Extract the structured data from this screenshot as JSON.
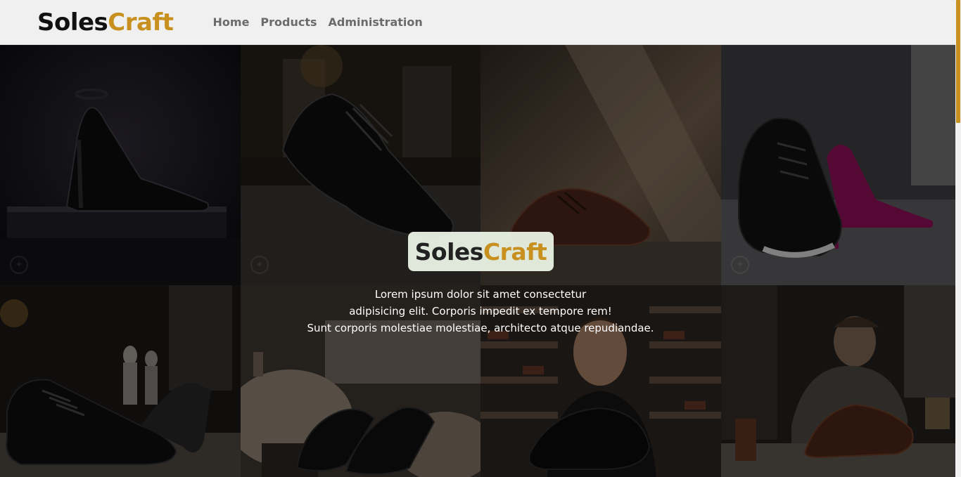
{
  "brand": {
    "part1": "Soles",
    "part2": "Craft",
    "accent_color": "#c8901e"
  },
  "nav": {
    "items": [
      {
        "label": "Home"
      },
      {
        "label": "Products"
      },
      {
        "label": "Administration"
      }
    ]
  },
  "hero": {
    "logo_part1": "Soles",
    "logo_part2": "Craft",
    "text_line1": "Lorem ipsum dolor sit amet consectetur",
    "text_line2": "adipisicing elit. Corporis impedit ex tempore rem!",
    "text_line3": "Sunt corporis molestiae molestiae, architecto atque repudiandae."
  },
  "gallery": {
    "images": [
      {
        "icon": "black-high-heel-image"
      },
      {
        "icon": "black-oxford-shoe-image"
      },
      {
        "icon": "brown-oxford-shoe-image"
      },
      {
        "icon": "sneaker-and-pink-heel-image"
      },
      {
        "icon": "sneaker-and-heel-store-image"
      },
      {
        "icon": "slip-on-shoes-image"
      },
      {
        "icon": "man-holding-shoe-image"
      },
      {
        "icon": "shoemaker-crafting-image"
      }
    ]
  }
}
